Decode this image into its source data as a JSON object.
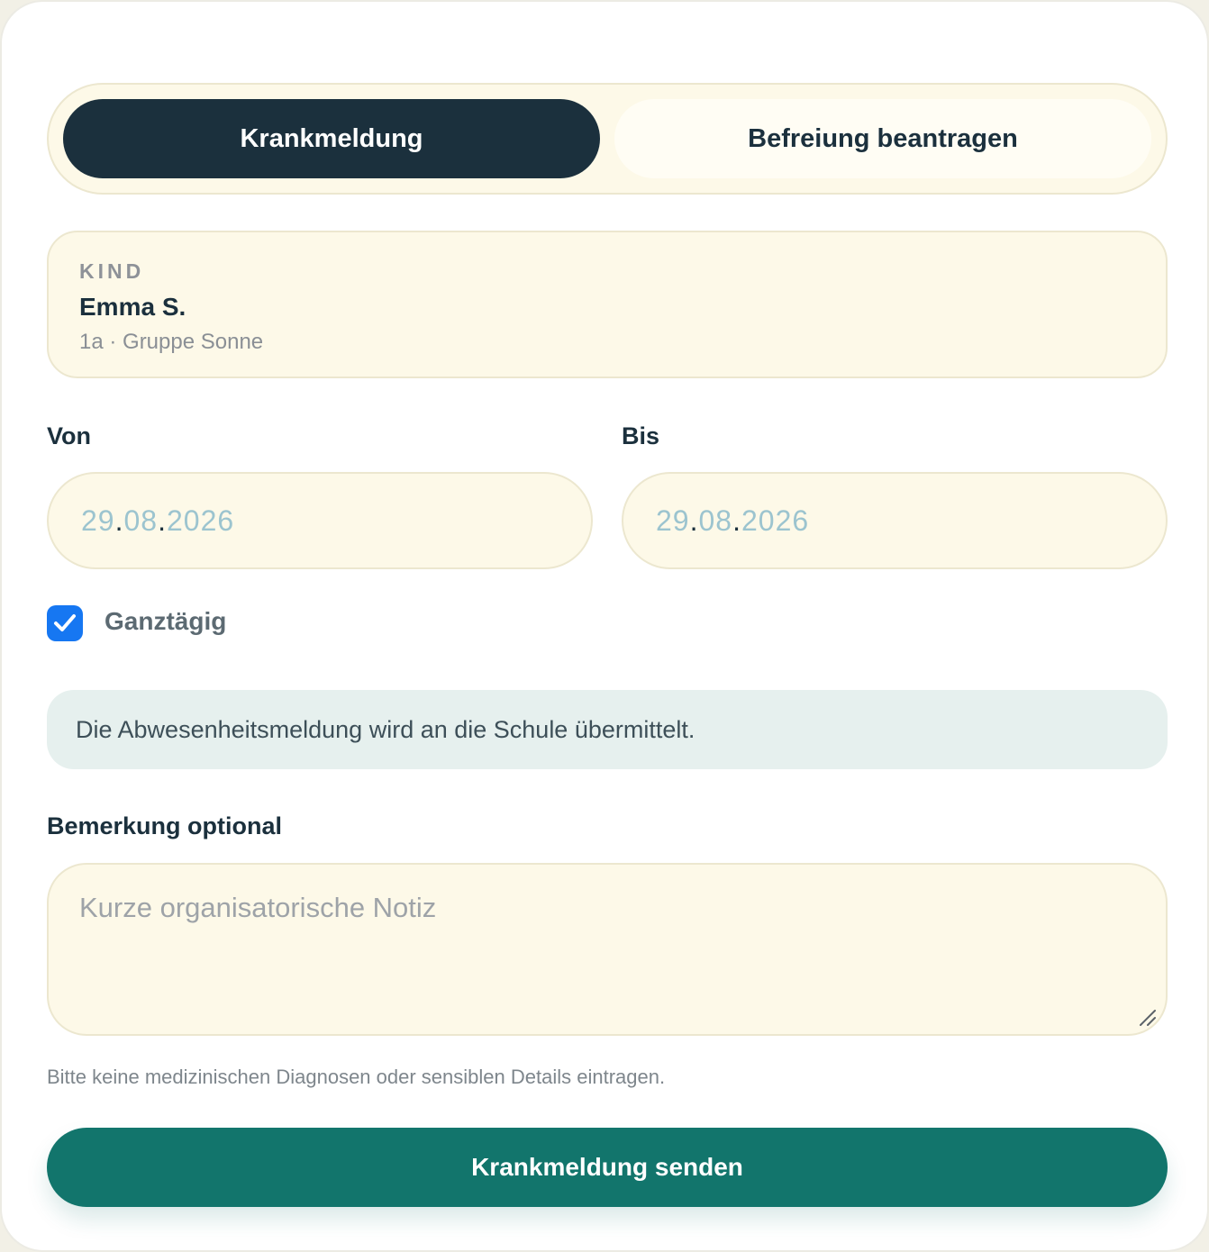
{
  "tabs": {
    "active_label": "Krankmeldung",
    "inactive_label": "Befreiung beantragen"
  },
  "child": {
    "label": "KIND",
    "name": "Emma S.",
    "group": "1a · Gruppe Sonne"
  },
  "dates": {
    "from_label": "Von",
    "from": {
      "day": "29",
      "month": "08",
      "year": "2026"
    },
    "to_label": "Bis",
    "to": {
      "day": "29",
      "month": "08",
      "year": "2026"
    }
  },
  "all_day": {
    "label": "Ganztägig",
    "checked": true
  },
  "info_text": "Die Abwesenheitsmeldung wird an die Schule übermittelt.",
  "remark": {
    "label": "Bemerkung optional",
    "placeholder": "Kurze organisatorische Notiz",
    "value": ""
  },
  "hint_text": "Bitte keine medizinischen Diagnosen oder sensiblen Details eintragen.",
  "submit_label": "Krankmeldung senden",
  "colors": {
    "primary_dark": "#1b303d",
    "accent_teal": "#12756c",
    "checkbox_blue": "#1677f2",
    "field_bg": "#fdf9e8",
    "info_bg": "#e6f0ee"
  }
}
